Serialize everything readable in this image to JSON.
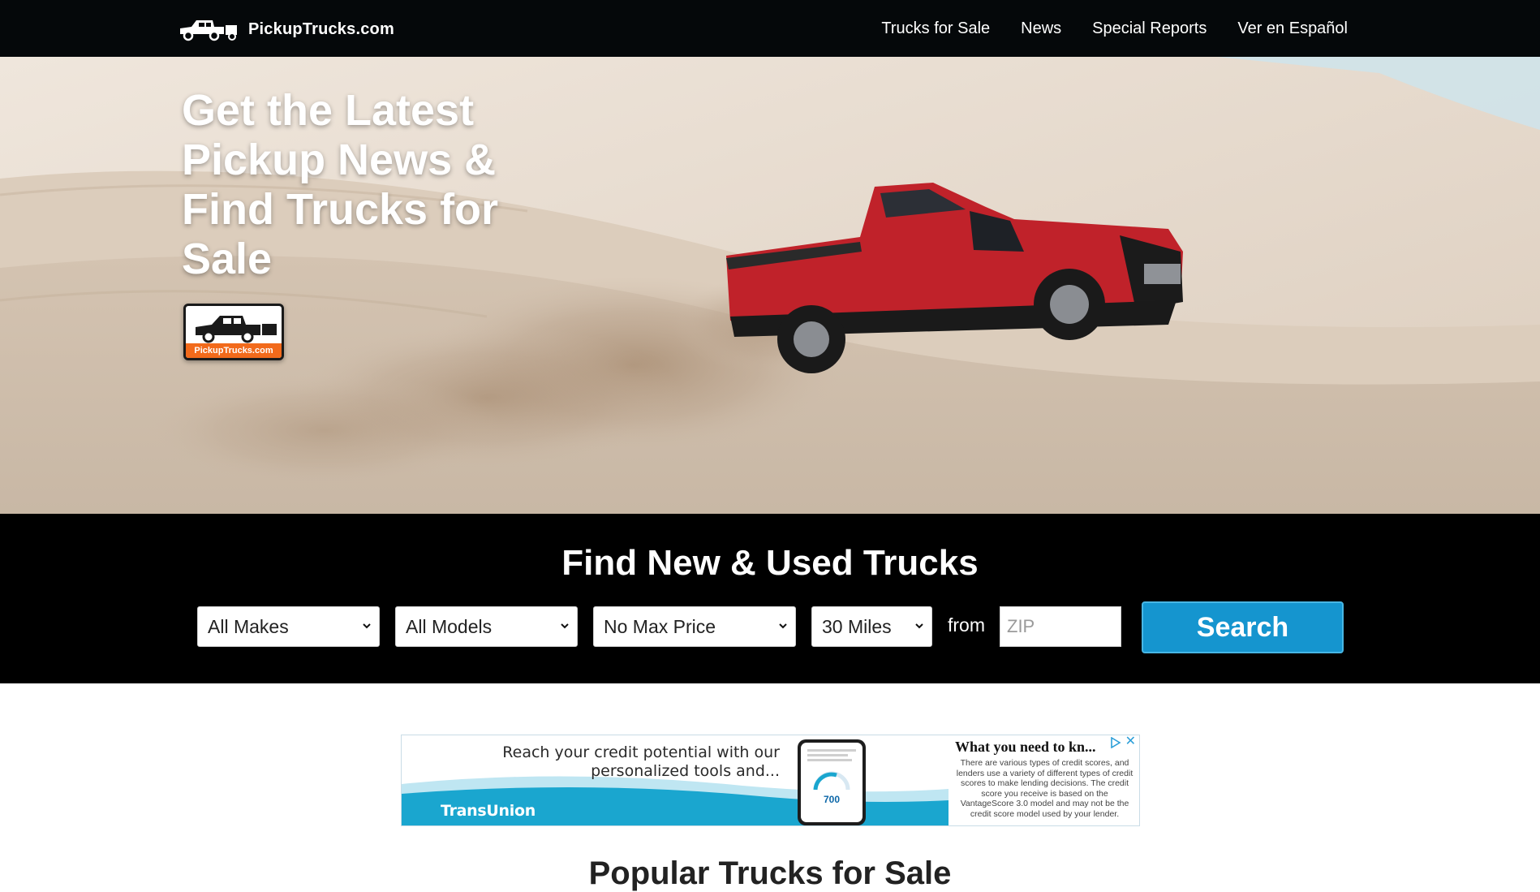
{
  "header": {
    "brand": "PickupTrucks.com",
    "nav": [
      {
        "label": "Trucks for Sale"
      },
      {
        "label": "News"
      },
      {
        "label": "Special Reports"
      },
      {
        "label": "Ver en Español"
      }
    ]
  },
  "hero": {
    "headline": "Get the Latest Pickup News & Find Trucks for Sale",
    "badge_text": "PickupTrucks.com",
    "image_subject": "red pickup truck driving over a sand dune"
  },
  "search": {
    "title": "Find New & Used Trucks",
    "make": {
      "selected": "All Makes"
    },
    "model": {
      "selected": "All Models"
    },
    "price": {
      "selected": "No Max Price"
    },
    "distance": {
      "selected": "30 Miles"
    },
    "from_label": "from",
    "zip": {
      "value": "",
      "placeholder": "ZIP"
    },
    "button_label": "Search",
    "button_color": "#1595cf"
  },
  "ad": {
    "copy": "Reach your credit potential with our personalized tools and...",
    "brand": "TransUnion",
    "score": "700",
    "right_title": "What you need to kn...",
    "right_body": "There are various types of credit scores, and lenders use a variety of different types of credit scores to make lending decisions. The credit score you receive is based on the VantageScore 3.0 model and may not be the credit score model used by your lender.",
    "close_glyph": "✕"
  },
  "section": {
    "popular_title": "Popular Trucks for Sale"
  },
  "colors": {
    "nav_bg": "#05080a",
    "band_bg": "#000000",
    "truck_red": "#c0222a",
    "badge_orange": "#f26a1b"
  }
}
